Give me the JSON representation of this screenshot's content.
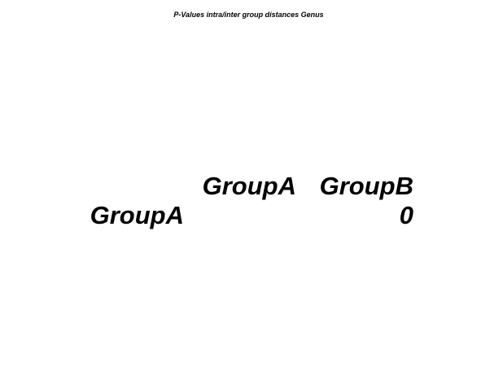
{
  "chart_data": {
    "type": "table",
    "title": "P-Values intra/inter group distances Genus",
    "columns": [
      "GroupA",
      "GroupB"
    ],
    "rows": [
      {
        "label": "GroupA",
        "values": [
          "",
          "0"
        ]
      }
    ]
  }
}
